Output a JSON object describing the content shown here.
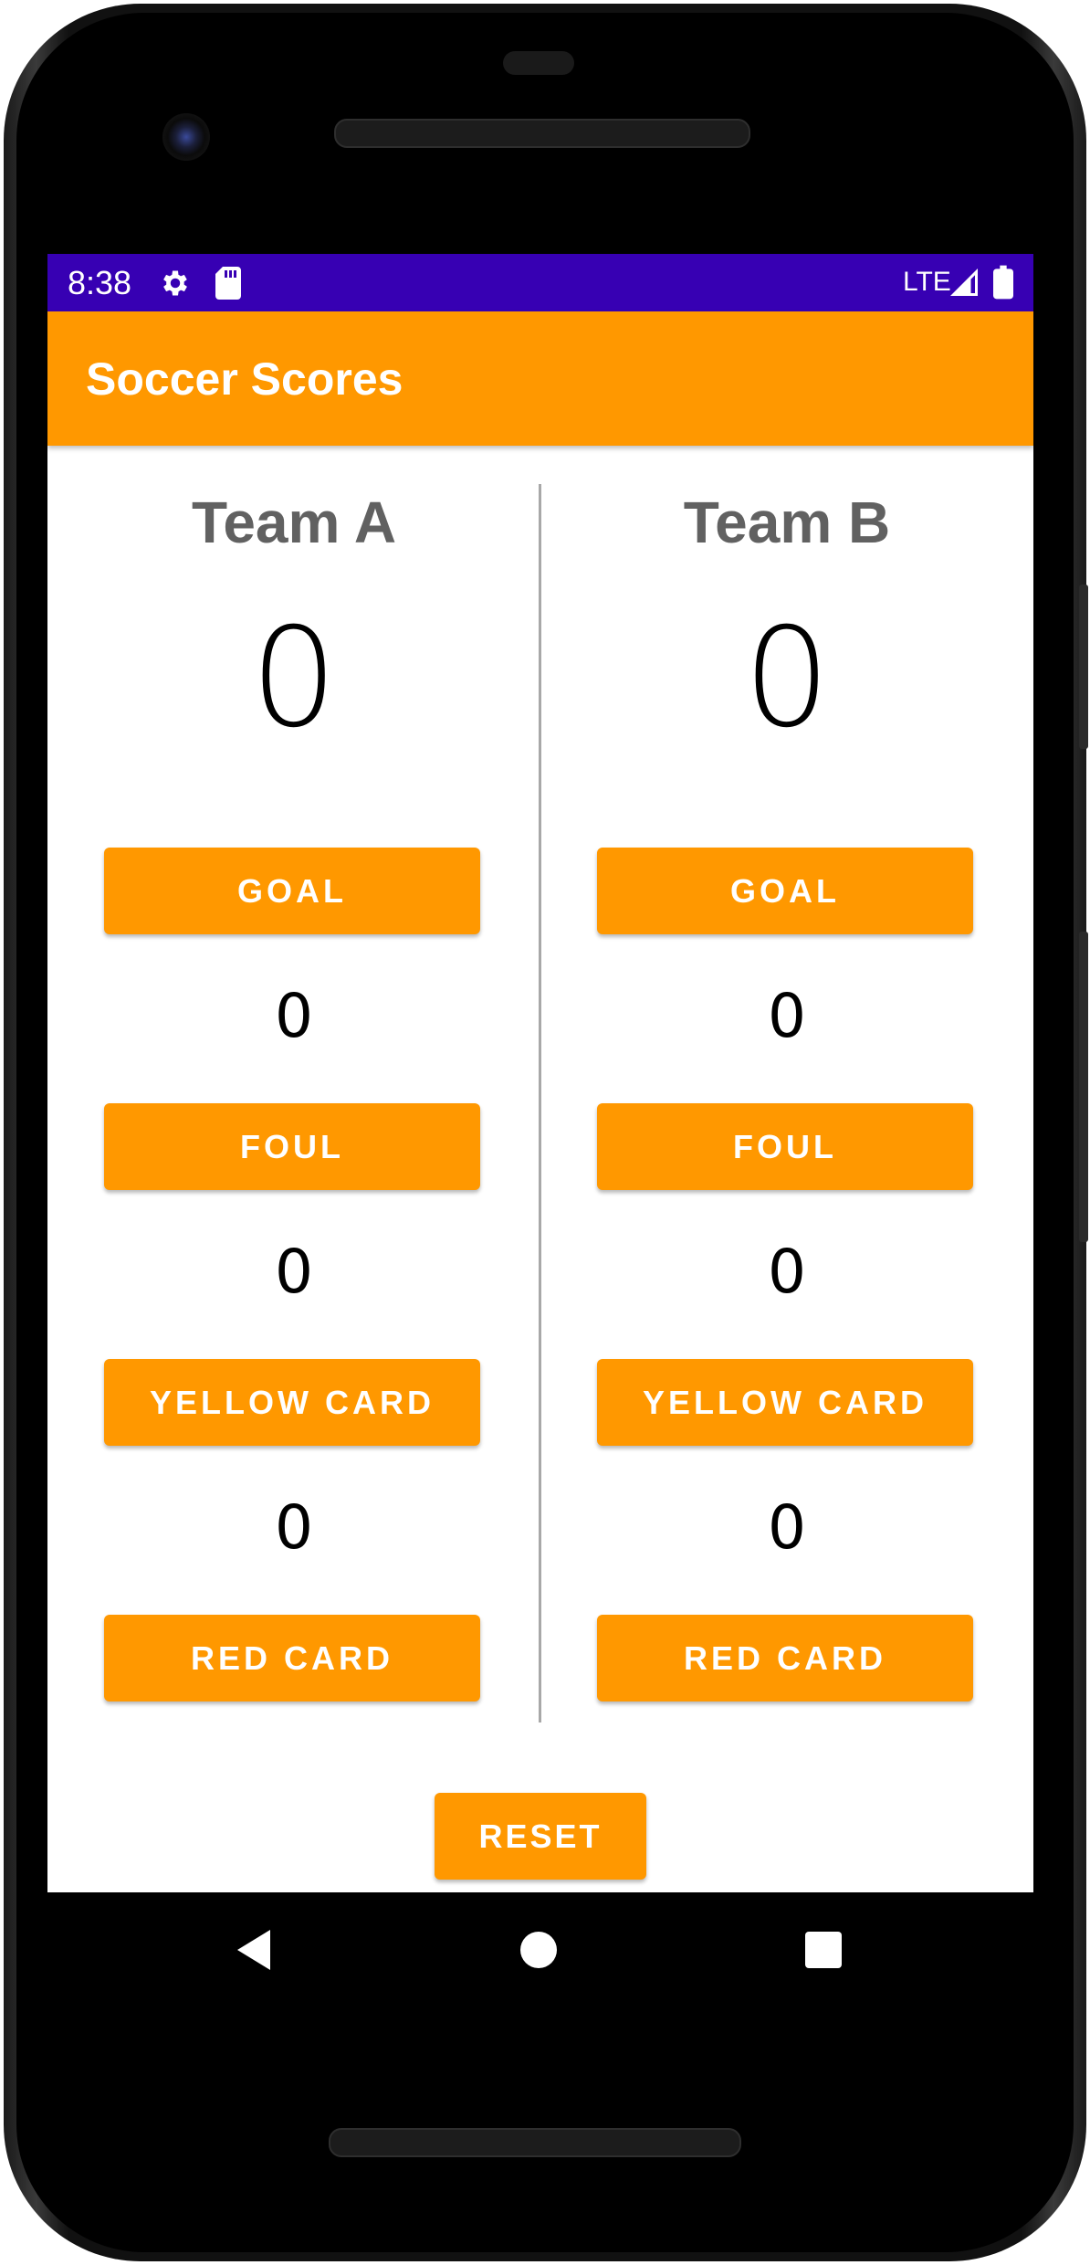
{
  "status_bar": {
    "time": "8:38",
    "network": "LTE",
    "icons": [
      "settings-icon",
      "sd-card-icon",
      "signal-icon",
      "battery-icon"
    ],
    "color": "#3700b3"
  },
  "app_bar": {
    "title": "Soccer Scores",
    "color": "#ff9800"
  },
  "teams": [
    {
      "name": "Team A",
      "score": "0",
      "goal_label": "GOAL",
      "fouls": "0",
      "foul_label": "FOUL",
      "yellow_cards": "0",
      "yellow_card_label": "YELLOW CARD",
      "red_cards": "0",
      "red_card_label": "RED CARD"
    },
    {
      "name": "Team B",
      "score": "0",
      "goal_label": "GOAL",
      "fouls": "0",
      "foul_label": "FOUL",
      "yellow_cards": "0",
      "yellow_card_label": "YELLOW CARD",
      "red_cards": "0",
      "red_card_label": "RED CARD"
    }
  ],
  "reset_label": "RESET",
  "nav_bar": {
    "icons": [
      "back-icon",
      "home-icon",
      "recents-icon"
    ]
  }
}
